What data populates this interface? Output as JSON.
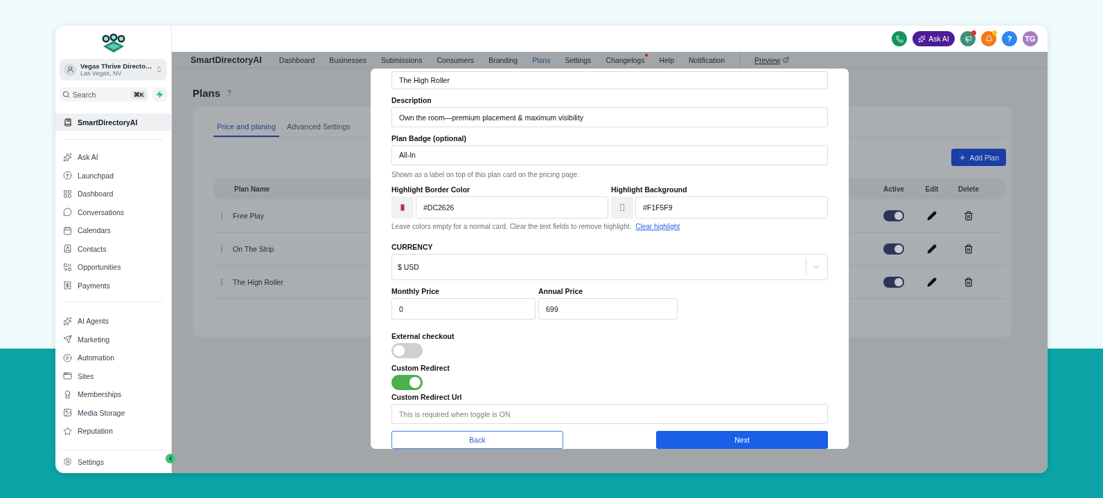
{
  "sidebar": {
    "location": {
      "name": "Vegas Thrive Directo…",
      "city": "Las Vegas, NV"
    },
    "search": {
      "placeholder": "Search",
      "shortcut": "⌘K"
    },
    "app_item": {
      "label": "SmartDirectoryAI",
      "selected": true
    },
    "groups": [
      [
        {
          "label": "Ask AI",
          "selected": false
        },
        {
          "label": "Launchpad",
          "selected": false
        },
        {
          "label": "Dashboard",
          "selected": false
        },
        {
          "label": "Conversations",
          "selected": false
        },
        {
          "label": "Calendars",
          "selected": false
        },
        {
          "label": "Contacts",
          "selected": false
        },
        {
          "label": "Opportunities",
          "selected": false
        },
        {
          "label": "Payments",
          "selected": false
        }
      ],
      [
        {
          "label": "AI Agents",
          "selected": false
        },
        {
          "label": "Marketing",
          "selected": false
        },
        {
          "label": "Automation",
          "selected": false
        },
        {
          "label": "Sites",
          "selected": false
        },
        {
          "label": "Memberships",
          "selected": false
        },
        {
          "label": "Media Storage",
          "selected": false
        },
        {
          "label": "Reputation",
          "selected": false
        }
      ]
    ],
    "settings": "Settings"
  },
  "top_bar": {
    "ask_ai": "Ask AI",
    "announcements_dot": true,
    "notifications_dot": true,
    "help": "?",
    "avatar": "TG"
  },
  "nav": {
    "brand": "SmartDirectoryAI",
    "items": [
      {
        "label": "Dashboard",
        "selected": false
      },
      {
        "label": "Businesses",
        "selected": false
      },
      {
        "label": "Submissions",
        "selected": false
      },
      {
        "label": "Consumers",
        "selected": false
      },
      {
        "label": "Branding",
        "selected": false
      },
      {
        "label": "Plans",
        "selected": true
      },
      {
        "label": "Settings",
        "selected": false
      },
      {
        "label": "Changelogs",
        "selected": false,
        "dot": true
      },
      {
        "label": "Help",
        "selected": false
      },
      {
        "label": "Notification",
        "selected": false
      }
    ],
    "preview": "Preview"
  },
  "page": {
    "title": "Plans",
    "help": "?",
    "tabs": [
      {
        "label": "Price and planing",
        "selected": true
      },
      {
        "label": "Advanced Settings",
        "selected": false
      }
    ],
    "add_button": "Add Plan",
    "table": {
      "columns": [
        "Plan Name",
        "Active",
        "Edit",
        "Delete"
      ],
      "rows": [
        {
          "name": "Free Play",
          "active": true
        },
        {
          "name": "On The Strip",
          "active": true
        },
        {
          "name": "The High Roller",
          "active": true
        }
      ]
    }
  },
  "modal": {
    "name_value": "The High Roller",
    "description": {
      "label": "Description",
      "value": "Own the room—premium placement & maximum visibility"
    },
    "badge": {
      "label": "Plan Badge (optional)",
      "value": "All-In",
      "hint": "Shown as a label on top of this plan card on the pricing page."
    },
    "highlight_border": {
      "label": "Highlight Border Color",
      "color": "#dc2626",
      "value": "#DC2626"
    },
    "highlight_background": {
      "label": "Highlight Background",
      "color": "#f1f5f9",
      "value": "#F1F5F9"
    },
    "highlight_hint": "Leave colors empty for a normal card. Clear the text fields to remove highlight.",
    "clear_link": "Clear highlight",
    "currency": {
      "label": "CURRENCY",
      "value": "$ USD"
    },
    "monthly": {
      "label": "Monthly Price",
      "value": "0"
    },
    "annual": {
      "label": "Annual Price",
      "value": "699"
    },
    "external_checkout": {
      "label": "External checkout",
      "on": false
    },
    "custom_redirect": {
      "label": "Custom Redirect",
      "on": true
    },
    "redirect_url": {
      "label": "Custom Redirect Url",
      "placeholder": "This is required when toggle is ON"
    },
    "back": "Back",
    "next": "Next"
  }
}
